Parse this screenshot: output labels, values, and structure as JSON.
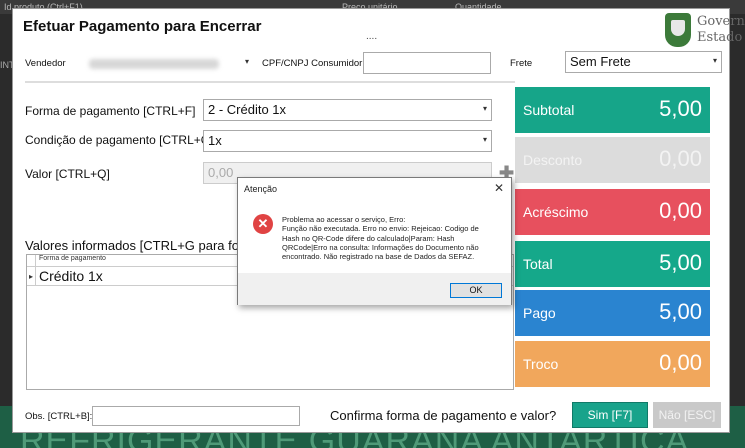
{
  "background": {
    "top_col1": "Id produto (Ctrl+F1)",
    "top_col2": "Preço unitário",
    "top_col3": "Quantidade",
    "left_fragment": "INT",
    "bottom_text": "REFRIGERANTE GUARANA ANTARTICA"
  },
  "window": {
    "title": "Efetuar Pagamento para Encerrar",
    "dots": "....",
    "logo_line1": "Governo",
    "logo_line2": "Estado"
  },
  "form": {
    "vendedor_label": "Vendedor",
    "cpf_label": "CPF/CNPJ Consumidor",
    "cpf_value": "",
    "frete_label": "Frete",
    "frete_value": "Sem Frete",
    "forma_label": "Forma de pagamento [CTRL+F]",
    "forma_value": "2 - Crédito 1x",
    "condicao_label": "Condição de pagamento [CTRL+O]",
    "condicao_value": "1x",
    "valor_label": "Valor [CTRL+Q]",
    "valor_value": "0,00",
    "valores_label": "Valores informados [CTRL+G para fo"
  },
  "grid": {
    "header": "Forma de pagamento",
    "rows": [
      "Crédito 1x"
    ]
  },
  "tiles": [
    {
      "label": "Subtotal",
      "value": "5,00",
      "color": "#16a589"
    },
    {
      "label": "Desconto",
      "value": "0,00",
      "color": "#dcdcdc"
    },
    {
      "label": "Acréscimo",
      "value": "0,00",
      "color": "#e7505e"
    },
    {
      "label": "Total",
      "value": "5,00",
      "color": "#15a88a"
    },
    {
      "label": "Pago",
      "value": "5,00",
      "color": "#2a84d0"
    },
    {
      "label": "Troco",
      "value": "0,00",
      "color": "#f1a75c"
    }
  ],
  "footer": {
    "obs_label": "Obs. [CTRL+B]:",
    "obs_value": "",
    "confirm_text": "Confirma forma de pagamento e valor?",
    "sim_label": "Sim [F7]",
    "nao_label": "Não [ESC]"
  },
  "dialog": {
    "title": "Atenção",
    "close": "✕",
    "icon": "error-icon",
    "message_lines": [
      "Problema ao acessar o serviço, Erro:",
      "Função não executada. Erro no envio: Rejeicao: Codigo de",
      "Hash no QR-Code difere do calculado|Param: Hash",
      "QRCode|Erro na consulta: Informações do Documento não",
      "encontrado. Não registrado na base de Dados da SEFAZ."
    ],
    "ok_label": "OK"
  }
}
